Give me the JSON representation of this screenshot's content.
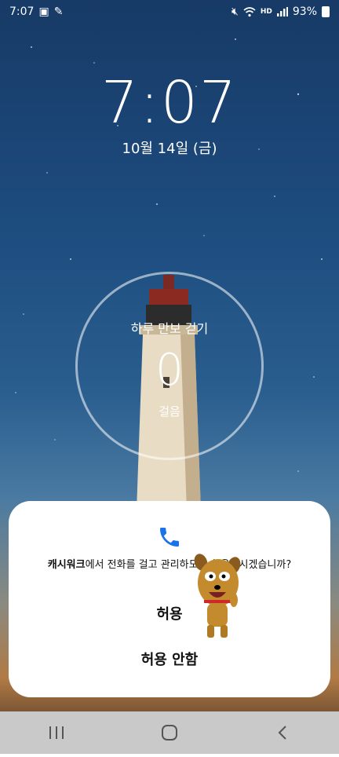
{
  "status_bar": {
    "time": "7:07",
    "battery": "93%",
    "hd_label": "HD"
  },
  "lock_screen": {
    "clock": "7:07",
    "date": "10월 14일 (금)"
  },
  "step_widget": {
    "title": "하루 만보 걷기",
    "count": "0",
    "unit": "걸음"
  },
  "dialog": {
    "app_name": "캐시워크",
    "message_rest": "에서 전화를 걸고 관리하도록 허용하시겠습니까?",
    "allow_label": "허용",
    "deny_label": "허용 안함",
    "accent_color": "#1a73e8"
  },
  "nav": {
    "recents_icon": "recents-icon",
    "home_icon": "home-icon",
    "back_icon": "back-icon"
  }
}
